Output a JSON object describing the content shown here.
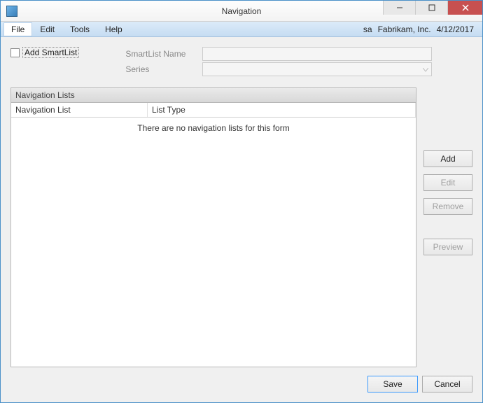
{
  "window": {
    "title": "Navigation"
  },
  "menubar": {
    "items": [
      "File",
      "Edit",
      "Tools",
      "Help"
    ],
    "user": "sa",
    "company": "Fabrikam, Inc.",
    "date": "4/12/2017"
  },
  "form": {
    "checkbox_label": "Add SmartList",
    "smartlist_name_label": "SmartList Name",
    "smartlist_name_value": "",
    "series_label": "Series",
    "series_value": ""
  },
  "panel": {
    "title": "Navigation Lists",
    "columns": [
      "Navigation List",
      "List Type"
    ],
    "empty_message": "There are no navigation lists for this form"
  },
  "side_buttons": {
    "add": "Add",
    "edit": "Edit",
    "remove": "Remove",
    "preview": "Preview"
  },
  "bottom_buttons": {
    "save": "Save",
    "cancel": "Cancel"
  }
}
